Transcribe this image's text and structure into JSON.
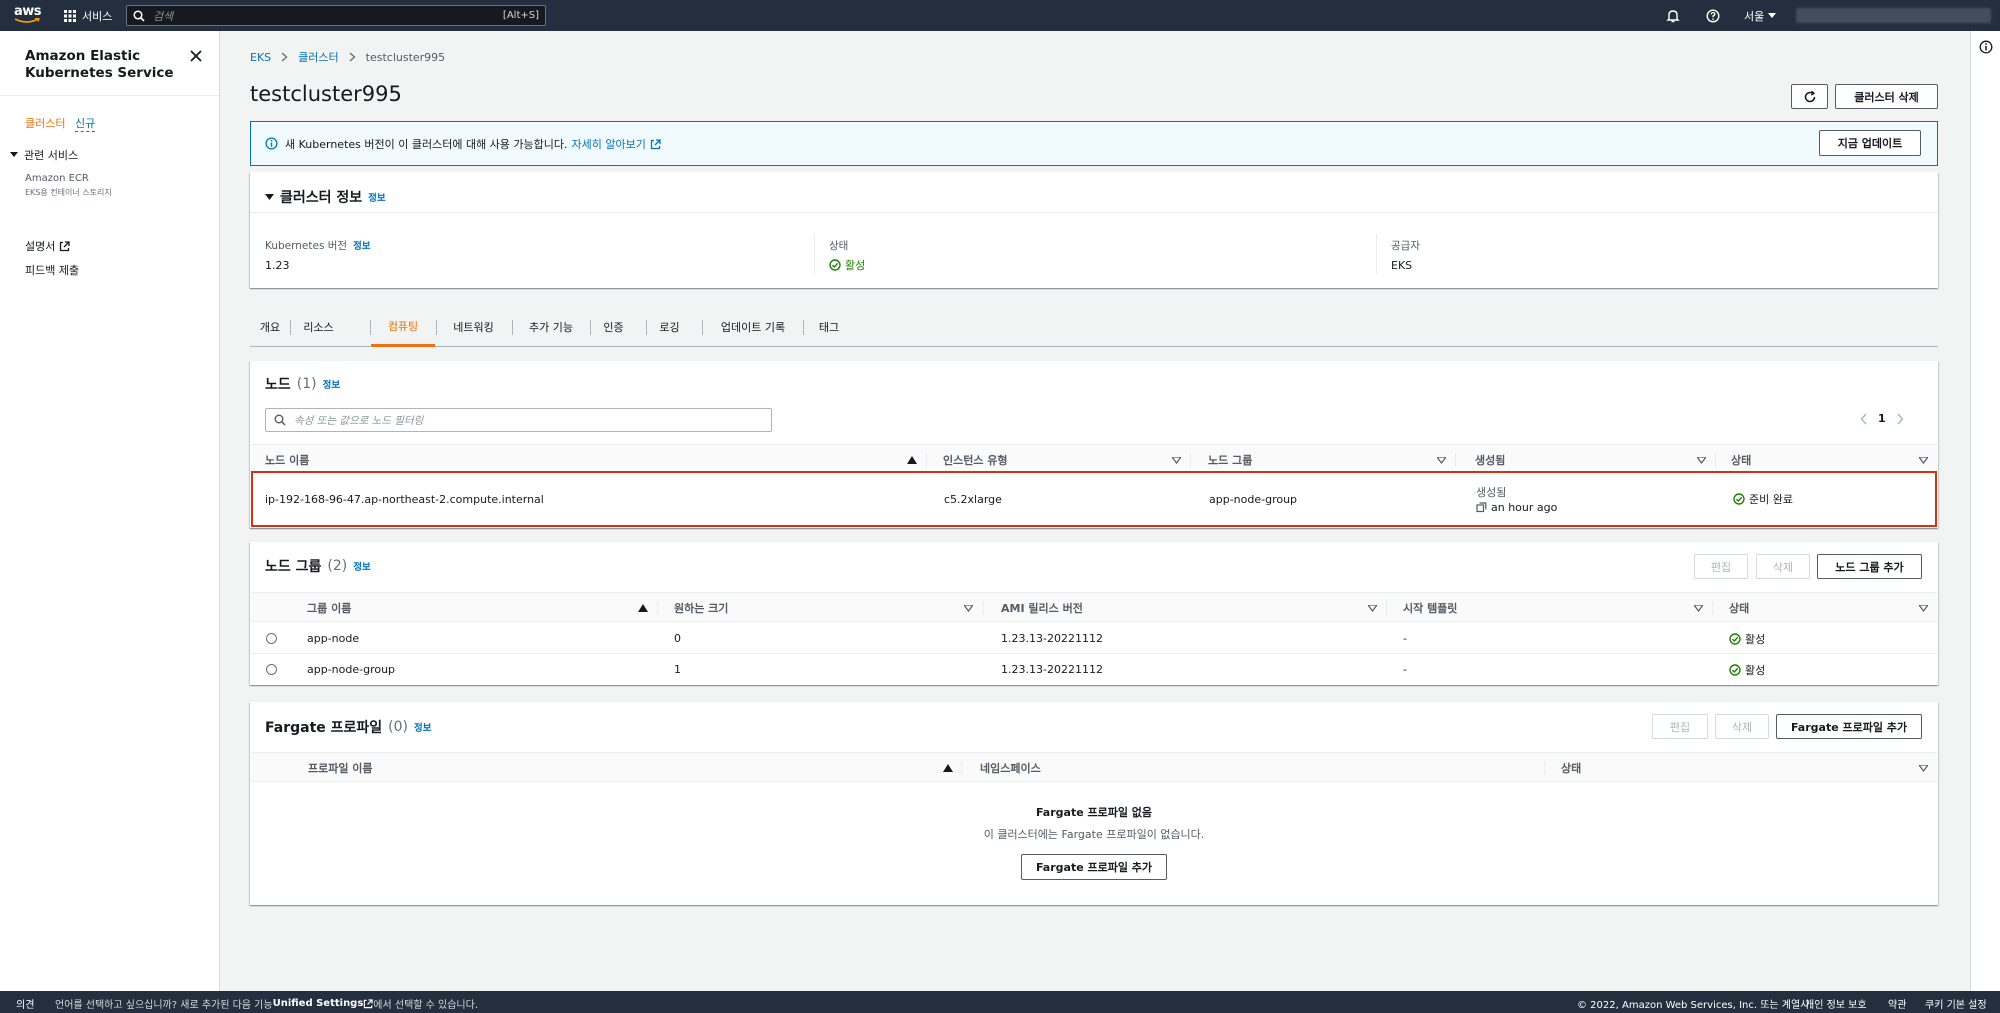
{
  "topnav": {
    "logo_text": "aws",
    "services_label": "서비스",
    "search_placeholder": "검색",
    "search_shortcut": "[Alt+S]",
    "region": "서울"
  },
  "sidebar": {
    "title": "Amazon Elastic Kubernetes Service",
    "clusters": "클러스터",
    "new_badge": "신규",
    "related_services": "관련 서비스",
    "ecr": "Amazon ECR",
    "ecr_sub": "EKS용 컨테이너 스토리지",
    "docs": "설명서",
    "feedback": "피드백 제출"
  },
  "breadcrumb": {
    "eks": "EKS",
    "clusters": "클러스터",
    "current": "testcluster995"
  },
  "page": {
    "title": "testcluster995",
    "delete_button": "클러스터 삭제"
  },
  "alert": {
    "message": "새 Kubernetes 버전이 이 클러스터에 대해 사용 가능합니다.",
    "link": "자세히 알아보기",
    "button": "지금 업데이트"
  },
  "cluster_info": {
    "title": "클러스터 정보",
    "info": "정보",
    "k8s_version_label": "Kubernetes 버전",
    "k8s_version_info": "정보",
    "k8s_version": "1.23",
    "status_label": "상태",
    "status": "활성",
    "provider_label": "공급자",
    "provider": "EKS"
  },
  "tabs": [
    {
      "label": "개요"
    },
    {
      "label": "리소스"
    },
    {
      "label": "컴퓨팅"
    },
    {
      "label": "네트워킹"
    },
    {
      "label": "추가 기능"
    },
    {
      "label": "인증"
    },
    {
      "label": "로깅"
    },
    {
      "label": "업데이트 기록"
    },
    {
      "label": "태그"
    }
  ],
  "nodes": {
    "title": "노드",
    "count": "(1)",
    "info": "정보",
    "filter_placeholder": "속성 또는 값으로 노드 필터링",
    "page": "1",
    "columns": [
      "노드 이름",
      "인스턴스 유형",
      "노드 그룹",
      "생성됨",
      "상태"
    ],
    "rows": [
      {
        "name": "ip-192-168-96-47.ap-northeast-2.compute.internal",
        "instance_type": "c5.2xlarge",
        "node_group": "app-node-group",
        "created_label": "생성됨",
        "created": "an hour ago",
        "status": "준비 완료"
      }
    ]
  },
  "node_groups": {
    "title": "노드 그룹",
    "count": "(2)",
    "info": "정보",
    "edit": "편집",
    "delete": "삭제",
    "add": "노드 그룹 추가",
    "columns": [
      "그룹 이름",
      "원하는 크기",
      "AMI 릴리스 버전",
      "시작 템플릿",
      "상태"
    ],
    "rows": [
      {
        "name": "app-node",
        "size": "0",
        "ami": "1.23.13-20221112",
        "template": "-",
        "status": "활성"
      },
      {
        "name": "app-node-group",
        "size": "1",
        "ami": "1.23.13-20221112",
        "template": "-",
        "status": "활성"
      }
    ]
  },
  "fargate": {
    "title": "Fargate 프로파일",
    "count": "(0)",
    "info": "정보",
    "edit": "편집",
    "delete": "삭제",
    "add": "Fargate 프로파일 추가",
    "columns": [
      "프로파일 이름",
      "네임스페이스",
      "상태"
    ],
    "empty_title": "Fargate 프로파일 없음",
    "empty_desc": "이 클러스터에는 Fargate 프로파일이 없습니다.",
    "empty_button": "Fargate 프로파일 추가"
  },
  "footer": {
    "feedback": "의견",
    "lang_prefix": "언어를 선택하고 싶으십니까? 새로 추가된 다음 기능",
    "unified": "Unified Settings",
    "lang_suffix": "에서 선택할 수 있습니다.",
    "copyright": "© 2022, Amazon Web Services, Inc. 또는 계열사.",
    "privacy": "개인 정보 보호",
    "terms": "약관",
    "cookies": "쿠키 기본 설정"
  },
  "colors": {
    "nav": "#232f3e",
    "link": "#0073bb",
    "accent": "#ec7211",
    "success": "#1d8102",
    "highlight": "#d13212"
  }
}
